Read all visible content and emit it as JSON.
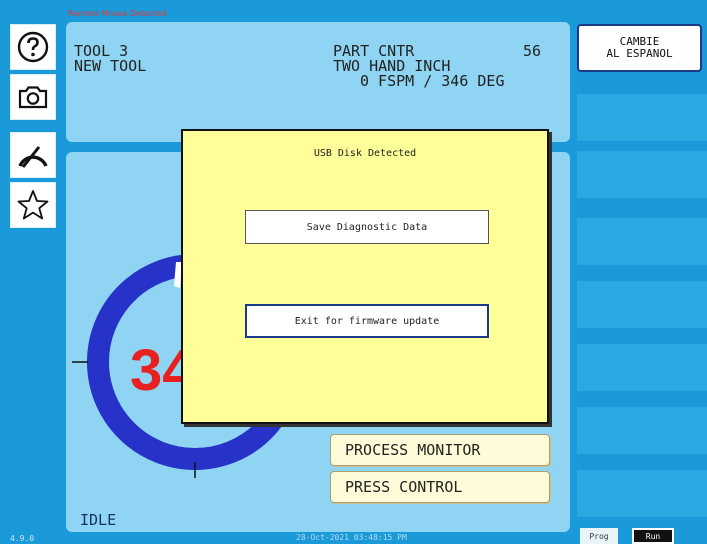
{
  "header": {
    "remote_notice": "Remote Mouse Detected"
  },
  "toolbar": {
    "icons": [
      "help-icon",
      "camera-icon",
      "gauge-icon",
      "star-icon"
    ]
  },
  "status": {
    "tool": "TOOL 3",
    "tool_name": "NEW TOOL",
    "part_counter_label": "PART CNTR",
    "part_counter_value": "56",
    "mode": "TWO HAND INCH",
    "speed_angle": "0 FSPM / 346 DEG"
  },
  "language_button": {
    "line1": "CAMBIE",
    "line2": "AL ESPANOL"
  },
  "gauge": {
    "readout": "34",
    "angle_deg": 346,
    "ring_color": "#2732c8",
    "readout_color": "#e82020"
  },
  "menu": {
    "process_monitor": "PROCESS MONITOR",
    "press_control": "PRESS CONTROL"
  },
  "dialog": {
    "title": "USB Disk Detected",
    "save_label": "Save Diagnostic Data",
    "exit_label": "Exit for firmware update"
  },
  "footer": {
    "state": "IDLE",
    "version": "4.9.0",
    "datetime": "28-Oct-2021 03:48:15 PM",
    "prog_label": "Prog",
    "run_label": "Run"
  },
  "colors": {
    "background": "#1a9ad8",
    "panel": "#8fd4f2",
    "dialog": "#ffff99",
    "menu_button": "#fffbd8"
  }
}
